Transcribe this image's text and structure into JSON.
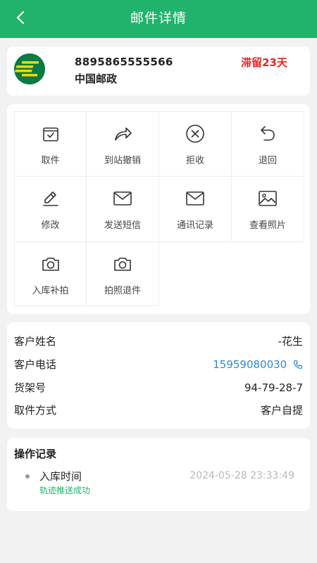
{
  "header": {
    "title": "邮件详情",
    "back_icon": "chevron-left-icon",
    "color": "#21b36b"
  },
  "parcel": {
    "tracking_number": "8895865555566",
    "carrier": "中国邮政",
    "stay_status": "滞留23天",
    "logo_icon": "china-post-logo",
    "status_color": "#e8231f"
  },
  "actions": [
    {
      "label": "取件",
      "icon": "pickup-box-icon"
    },
    {
      "label": "到站撤销",
      "icon": "forward-arrow-icon"
    },
    {
      "label": "拒收",
      "icon": "reject-x-icon"
    },
    {
      "label": "退回",
      "icon": "return-arrow-icon"
    },
    {
      "label": "修改",
      "icon": "pencil-icon"
    },
    {
      "label": "发送短信",
      "icon": "envelope-icon"
    },
    {
      "label": "通讯记录",
      "icon": "envelope-icon"
    },
    {
      "label": "查看照片",
      "icon": "image-icon"
    },
    {
      "label": "入库补拍",
      "icon": "camera-icon"
    },
    {
      "label": "拍照退件",
      "icon": "camera-icon"
    }
  ],
  "customer": {
    "name_label": "客户姓名",
    "name_value": "-花生",
    "phone_label": "客户电话",
    "phone_value": "15959080030",
    "phone_icon": "phone-icon",
    "shelf_label": "货架号",
    "shelf_value": "94-79-28-7",
    "pickup_label": "取件方式",
    "pickup_value": "客户自提",
    "link_color": "#2b89d6"
  },
  "log": {
    "title": "操作记录",
    "entries": [
      {
        "event": "入库时间",
        "time": "2024-05-28 23:33:49",
        "status": "轨迹推送成功"
      }
    ]
  }
}
